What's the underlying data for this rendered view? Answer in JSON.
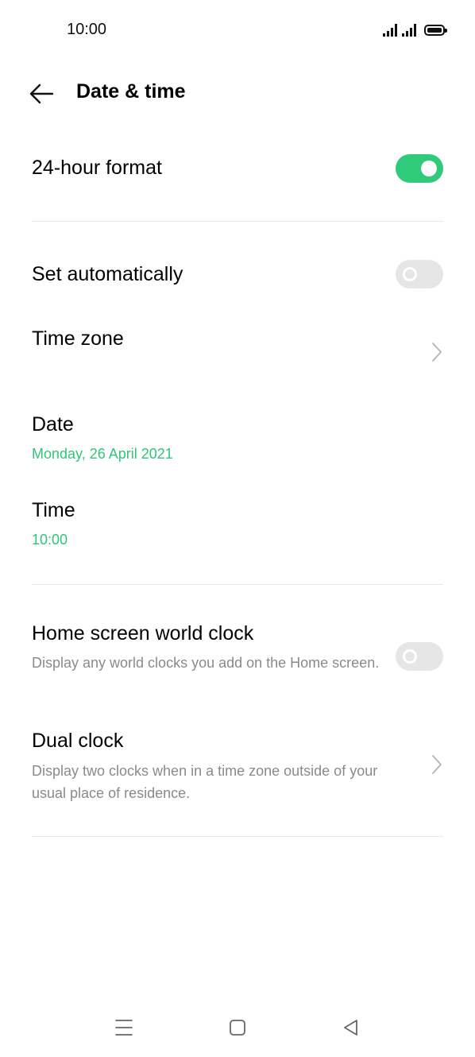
{
  "status_bar": {
    "time": "10:00"
  },
  "header": {
    "title": "Date & time"
  },
  "settings": {
    "hour_format": {
      "label": "24-hour format",
      "enabled": true
    },
    "set_automatically": {
      "label": "Set automatically",
      "enabled": false
    },
    "time_zone": {
      "label": "Time zone"
    },
    "date": {
      "label": "Date",
      "value": "Monday, 26 April 2021"
    },
    "time": {
      "label": "Time",
      "value": "10:00"
    },
    "home_world_clock": {
      "label": "Home screen world clock",
      "description": "Display any world clocks you add on the Home screen.",
      "enabled": false
    },
    "dual_clock": {
      "label": "Dual clock",
      "description": "Display two clocks when in a time zone outside of your usual place of residence."
    }
  },
  "colors": {
    "accent": "#2fc57a",
    "toggle_on": "#2fcb7b",
    "toggle_off": "#e6e6e6"
  },
  "icons": [
    "back-arrow-icon",
    "chevron-right-icon",
    "menu-icon",
    "home-icon",
    "back-triangle-icon"
  ]
}
